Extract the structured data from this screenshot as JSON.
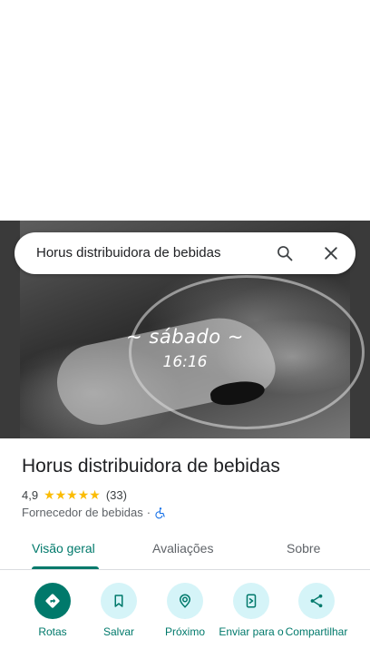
{
  "photo": {
    "overlay_day": "~ sábado ~",
    "overlay_time": "16:16"
  },
  "search": {
    "query": "Horus distribuidora de bebidas",
    "search_icon": "search-icon",
    "close_icon": "close-icon"
  },
  "place": {
    "title": "Horus distribuidora de bebidas",
    "rating": "4,9",
    "stars": "★★★★★",
    "review_count": "(33)",
    "category": "Fornecedor de bebidas",
    "separator": "·",
    "accessibility_icon": "wheelchair-icon"
  },
  "tabs": [
    {
      "label": "Visão geral",
      "active": true
    },
    {
      "label": "Avaliações",
      "active": false
    },
    {
      "label": "Sobre",
      "active": false
    }
  ],
  "actions": [
    {
      "label": "Rotas",
      "icon": "directions-icon"
    },
    {
      "label": "Salvar",
      "icon": "bookmark-icon"
    },
    {
      "label": "Próximo",
      "icon": "nearby-icon"
    },
    {
      "label": "Enviar para o",
      "icon": "send-to-phone-icon"
    },
    {
      "label": "Compartilhar",
      "icon": "share-icon"
    }
  ],
  "colors": {
    "accent": "#00796b",
    "action_bg": "#d5f4f8",
    "star": "#fbbc04"
  }
}
